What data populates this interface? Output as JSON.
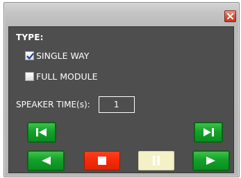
{
  "dialog": {
    "close_icon": "close-icon",
    "type_heading": "TYPE:",
    "options": [
      {
        "label": "SINGLE WAY",
        "checked": true
      },
      {
        "label": "FULL MODULE",
        "checked": false
      }
    ],
    "speaker_time": {
      "label": "SPEAKER TIME(s):",
      "value": "1"
    },
    "controls": {
      "previous_icon": "skip-previous-icon",
      "next_icon": "skip-next-icon",
      "back_icon": "play-reverse-icon",
      "stop_icon": "stop-icon",
      "pause_icon": "pause-icon",
      "play_icon": "play-icon"
    }
  },
  "colors": {
    "panel": "#4e4e4e",
    "green_button": "#13a22a",
    "stop_button": "#f52a09",
    "pause_button": "#f4f1c6"
  }
}
